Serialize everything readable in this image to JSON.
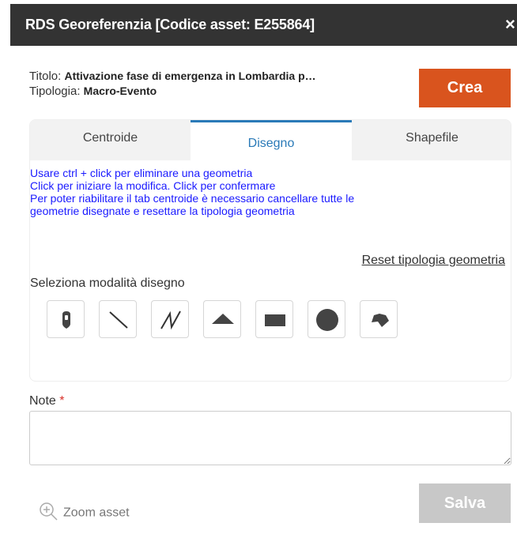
{
  "dialog": {
    "title": "RDS Georeferenzia [Codice asset: E255864]",
    "close_label": "×"
  },
  "meta": {
    "titolo_label": "Titolo: ",
    "titolo_value": "Attivazione fase di emergenza in Lombardia p…",
    "tipologia_label": "Tipologia: ",
    "tipologia_value": "Macro-Evento"
  },
  "actions": {
    "crea_label": "Crea",
    "salva_label": "Salva",
    "zoom_label": "Zoom asset"
  },
  "tabs": [
    {
      "label": "Centroide",
      "active": false
    },
    {
      "label": "Disegno",
      "active": true
    },
    {
      "label": "Shapefile",
      "active": false
    }
  ],
  "instructions": [
    "Usare ctrl + click per eliminare una geometria",
    "Click per iniziare la modifica. Click per confermare",
    "Per poter riabilitare il tab centroide è necessario cancellare tutte le",
    "geometrie disegnate e resettare la tipologia geometria"
  ],
  "reset_label": "Reset tipologia geometria",
  "mode_label": "Seleziona modalità disegno",
  "draw_modes": [
    {
      "name": "marker",
      "icon": "marker-icon"
    },
    {
      "name": "line",
      "icon": "line-icon"
    },
    {
      "name": "polyline",
      "icon": "polyline-icon"
    },
    {
      "name": "triangle",
      "icon": "triangle-icon"
    },
    {
      "name": "rectangle",
      "icon": "rectangle-icon"
    },
    {
      "name": "circle",
      "icon": "circle-icon"
    },
    {
      "name": "polygon",
      "icon": "polygon-icon"
    }
  ],
  "note": {
    "label": "Note",
    "required_mark": "*",
    "value": ""
  },
  "colors": {
    "titlebar": "#333333",
    "crea": "#d9541e",
    "active_tab": "#2a7ab8",
    "instructions": "#1a1aff",
    "salva_disabled": "#c8c8c8"
  }
}
